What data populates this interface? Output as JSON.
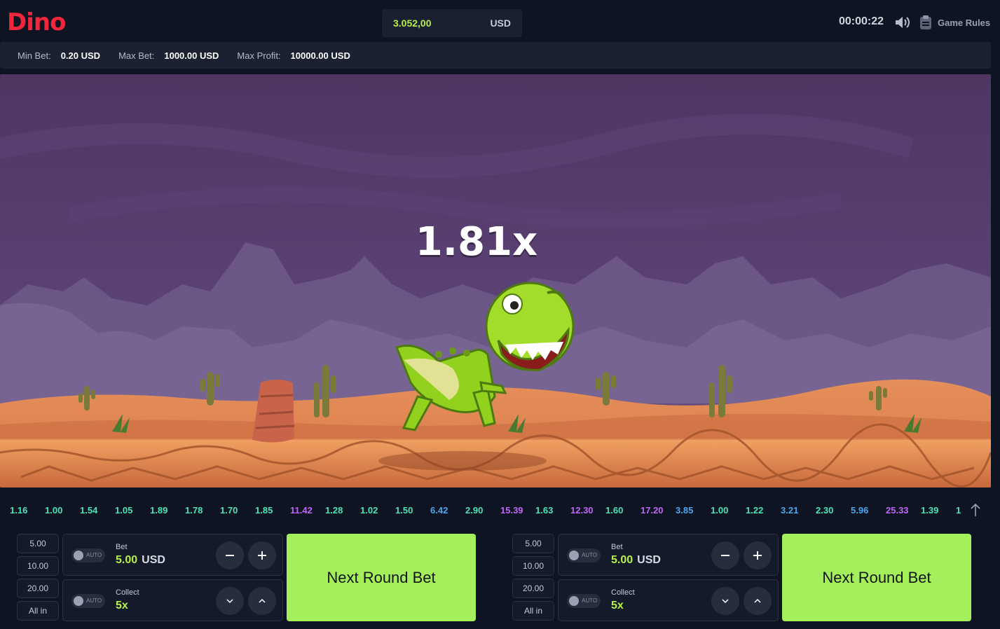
{
  "app": {
    "logo": "Dino"
  },
  "header": {
    "balance": "3.052,00",
    "currency": "USD",
    "timer": "00:00:22",
    "rules_label": "Game Rules"
  },
  "limits": {
    "min_label": "Min Bet:",
    "min_value": "0.20 USD",
    "max_label": "Max Bet:",
    "max_value": "1000.00 USD",
    "profit_label": "Max Profit:",
    "profit_value": "10000.00 USD"
  },
  "game": {
    "multiplier": "1.81x"
  },
  "history": [
    {
      "v": "1.16",
      "c": "#4be3b8"
    },
    {
      "v": "1.00",
      "c": "#4be3b8"
    },
    {
      "v": "1.54",
      "c": "#4be3b8"
    },
    {
      "v": "1.05",
      "c": "#4be3b8"
    },
    {
      "v": "1.89",
      "c": "#4be3b8"
    },
    {
      "v": "1.78",
      "c": "#4be3b8"
    },
    {
      "v": "1.70",
      "c": "#4be3b8"
    },
    {
      "v": "1.85",
      "c": "#4be3b8"
    },
    {
      "v": "11.42",
      "c": "#c066f5"
    },
    {
      "v": "1.28",
      "c": "#4be3b8"
    },
    {
      "v": "1.02",
      "c": "#4be3b8"
    },
    {
      "v": "1.50",
      "c": "#4be3b8"
    },
    {
      "v": "6.42",
      "c": "#4aa8f0"
    },
    {
      "v": "2.90",
      "c": "#4be3b8"
    },
    {
      "v": "15.39",
      "c": "#c066f5"
    },
    {
      "v": "1.63",
      "c": "#4be3b8"
    },
    {
      "v": "12.30",
      "c": "#c066f5"
    },
    {
      "v": "1.60",
      "c": "#4be3b8"
    },
    {
      "v": "17.20",
      "c": "#c066f5"
    },
    {
      "v": "3.85",
      "c": "#4aa8f0"
    },
    {
      "v": "1.00",
      "c": "#4be3b8"
    },
    {
      "v": "1.22",
      "c": "#4be3b8"
    },
    {
      "v": "3.21",
      "c": "#4aa8f0"
    },
    {
      "v": "2.30",
      "c": "#4be3b8"
    },
    {
      "v": "5.96",
      "c": "#4aa8f0"
    },
    {
      "v": "25.33",
      "c": "#c066f5"
    },
    {
      "v": "1.39",
      "c": "#4be3b8"
    },
    {
      "v": "1",
      "c": "#4be3b8"
    }
  ],
  "panels": [
    {
      "quick": [
        "5.00",
        "10.00",
        "20.00",
        "All in"
      ],
      "auto_label": "AUTO",
      "bet_label": "Bet",
      "bet_value": "5.00",
      "bet_currency": "USD",
      "collect_label": "Collect",
      "collect_value": "5x",
      "button_label": "Next Round Bet"
    },
    {
      "quick": [
        "5.00",
        "10.00",
        "20.00",
        "All in"
      ],
      "auto_label": "AUTO",
      "bet_label": "Bet",
      "bet_value": "5.00",
      "bet_currency": "USD",
      "collect_label": "Collect",
      "collect_value": "5x",
      "button_label": "Next Round Bet"
    }
  ],
  "colors": {
    "accent": "#a3f05c",
    "brand": "#f0263c",
    "background": "#0f1423"
  }
}
